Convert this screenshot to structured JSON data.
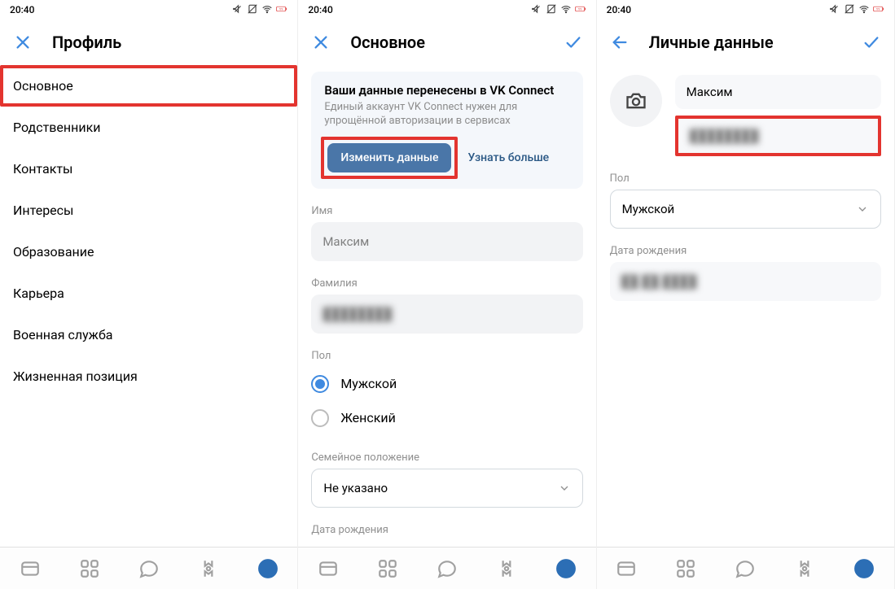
{
  "status": {
    "time": "20:40",
    "battery": "11"
  },
  "screen1": {
    "title": "Профиль",
    "items": [
      "Основное",
      "Родственники",
      "Контакты",
      "Интересы",
      "Образование",
      "Карьера",
      "Военная служба",
      "Жизненная позиция"
    ]
  },
  "screen2": {
    "title": "Основное",
    "card": {
      "title": "Ваши данные перенесены в VK Connect",
      "subtitle": "Единый аккаунт VK Connect нужен для упрощённой авторизации в сервисах",
      "primary": "Изменить данные",
      "link": "Узнать больше"
    },
    "labels": {
      "name": "Имя",
      "surname": "Фамилия",
      "gender": "Пол",
      "marital": "Семейное положение",
      "dob": "Дата рождения"
    },
    "values": {
      "name": "Максим",
      "surname": "████████"
    },
    "gender": {
      "male": "Мужской",
      "female": "Женский"
    },
    "marital": "Не указано"
  },
  "screen3": {
    "title": "Личные данные",
    "name": "Максим",
    "surname": "████████",
    "labels": {
      "gender": "Пол",
      "dob": "Дата рождения"
    },
    "gender_value": "Мужской",
    "dob": "██.██.████"
  }
}
